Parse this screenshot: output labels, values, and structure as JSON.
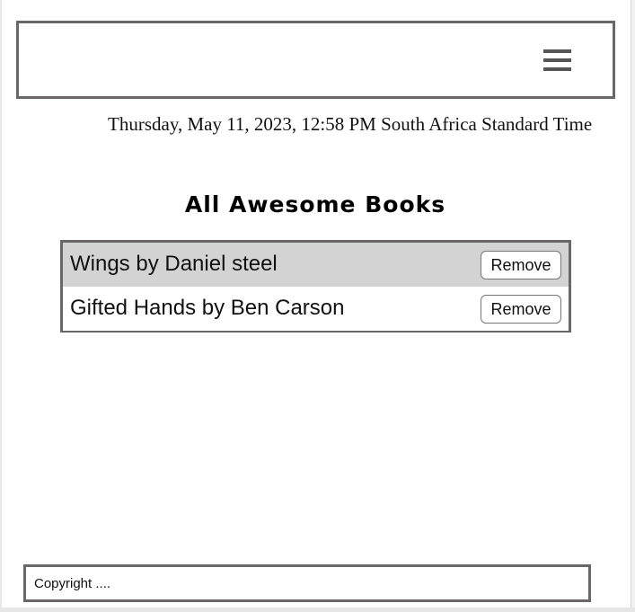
{
  "header": {
    "menu_icon": "hamburger-menu-icon"
  },
  "datetime": {
    "text": "Thursday, May 11, 2023, 12:58 PM South Africa Standard Time"
  },
  "books": {
    "title": "All Awesome Books",
    "items": [
      {
        "label": "Wings by Daniel steel",
        "action": "Remove"
      },
      {
        "label": "Gifted Hands by Ben Carson",
        "action": "Remove"
      }
    ]
  },
  "footer": {
    "text": "Copyright ...."
  },
  "colors": {
    "border": "#6b6667",
    "row_highlight": "#d3d3d3",
    "menu_icon": "#555555"
  }
}
